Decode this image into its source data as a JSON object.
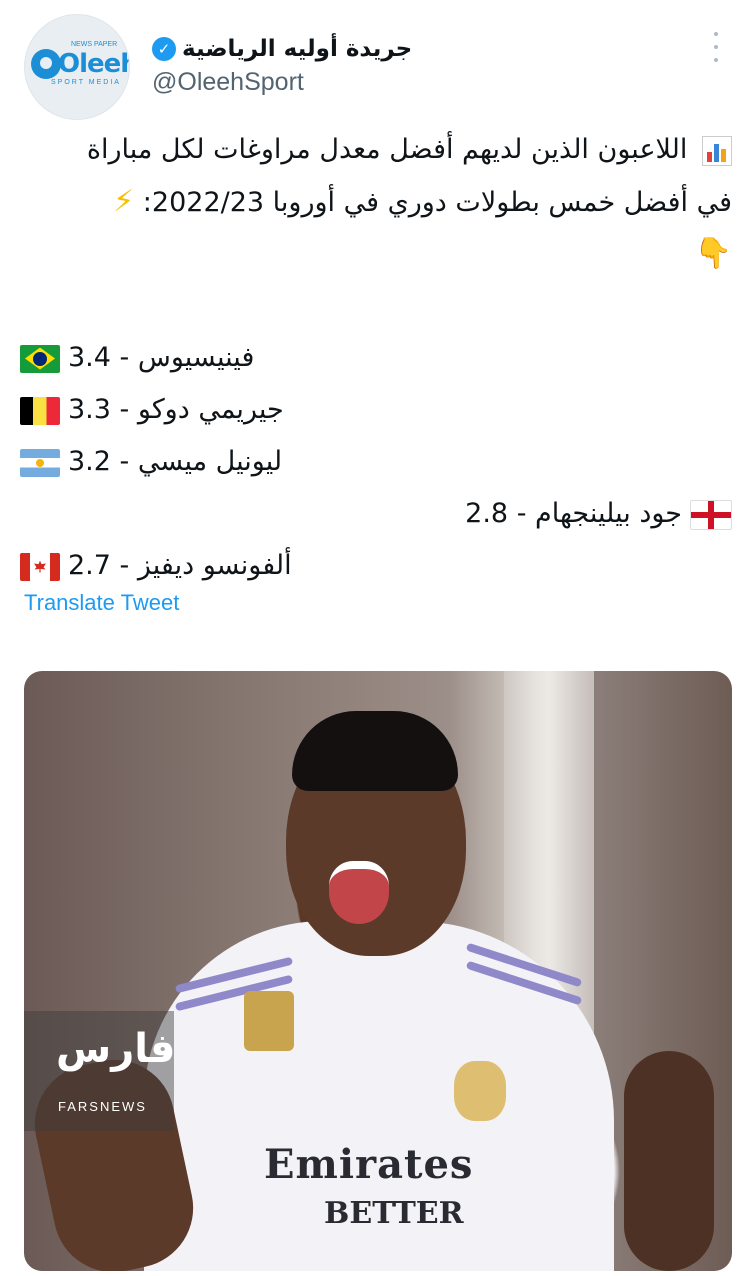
{
  "account": {
    "display_name": "جريدة أوليه الرياضية",
    "handle": "@OleehSport",
    "verified": true,
    "avatar_logo": {
      "main": "Oleeh",
      "top": "NEWS PAPER",
      "sub": "SPORT MEDIA"
    }
  },
  "tweet": {
    "lines": [
      "اللاعبون الذين لديهم أفضل معدل مراوغات لكل مباراة",
      "في أفضل خمس بطولات دوري في أوروبا 2022/23:"
    ],
    "players": [
      {
        "name": "فينيسيوس",
        "value": "3.4",
        "flag": "brazil"
      },
      {
        "name": "جيريمي دوكو",
        "value": "3.3",
        "flag": "belgium"
      },
      {
        "name": "ليونيل ميسي",
        "value": "3.2",
        "flag": "argentina"
      },
      {
        "name": "جود بيلينجهام",
        "value": "2.8",
        "flag": "england"
      },
      {
        "name": "ألفونسو ديفيز",
        "value": "2.7",
        "flag": "canada"
      }
    ],
    "separator": " - ",
    "emojis": {
      "chart": "chart-emoji",
      "bolt": "⚡",
      "pointing_down": "👇"
    }
  },
  "actions": {
    "translate": "Translate Tweet"
  },
  "media": {
    "watermark_logo": "فارس",
    "watermark_text": "FARSNEWS",
    "jersey_sponsor_line1": "Emirates",
    "jersey_sponsor_line2": "BETTER"
  },
  "colors": {
    "link": "#1d9bf0",
    "handle": "#536471",
    "verified": "#1d9bf0"
  }
}
